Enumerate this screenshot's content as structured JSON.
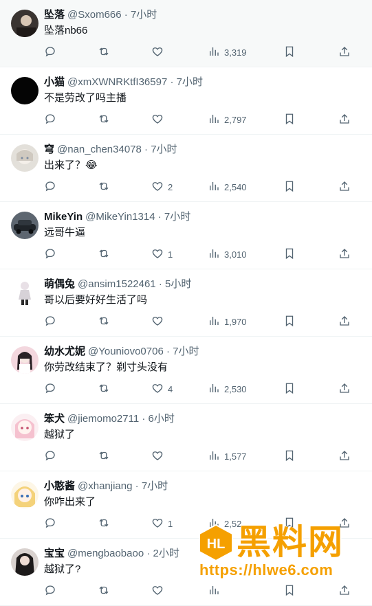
{
  "tweets": [
    {
      "name": "坠落",
      "handle": "@Sxom666",
      "time": "7小时",
      "text": "坠落nb66",
      "likes": "",
      "views": "3,319",
      "avatar": "dark-photo"
    },
    {
      "name": "小猫",
      "handle": "@xmXWNRKtfI36597",
      "time": "7小时",
      "text": "不是劳改了吗主播",
      "likes": "",
      "views": "2,797",
      "avatar": "black"
    },
    {
      "name": "穹",
      "handle": "@nan_chen34078",
      "time": "7小时",
      "text": "出来了？😂",
      "likes": "2",
      "views": "2,540",
      "avatar": "anime-white"
    },
    {
      "name": "MikeYin",
      "handle": "@MikeYin1314",
      "time": "7小时",
      "text": "远哥牛逼",
      "likes": "1",
      "views": "3,010",
      "avatar": "car"
    },
    {
      "name": "萌偶兔",
      "handle": "@ansim1522461",
      "time": "5小时",
      "text": "哥以后要好好生活了吗",
      "likes": "",
      "views": "1,970",
      "avatar": "figure"
    },
    {
      "name": "幼水尤妮",
      "handle": "@Youniovo0706",
      "time": "7小时",
      "text": "你劳改结束了？剃寸头没有",
      "likes": "4",
      "views": "2,530",
      "avatar": "pink-girl"
    },
    {
      "name": "笨犬",
      "handle": "@jiemomo2711",
      "time": "6小时",
      "text": "越狱了",
      "likes": "",
      "views": "1,577",
      "avatar": "pink-anime"
    },
    {
      "name": "小憨酱",
      "handle": "@xhanjiang",
      "time": "7小时",
      "text": "你咋出来了",
      "likes": "1",
      "views": "2,52",
      "avatar": "blonde-anime"
    },
    {
      "name": "宝宝",
      "handle": "@mengbaobaoo",
      "time": "2小时",
      "text": "越狱了?",
      "likes": "",
      "views": "",
      "avatar": "dark-girl"
    }
  ],
  "watermark": {
    "title": "黑料网",
    "url": "https://hlwe6.com"
  },
  "colors": {
    "text": "#0f1419",
    "secondary": "#536471",
    "border": "#eff3f4",
    "watermark": "#f5a000"
  }
}
